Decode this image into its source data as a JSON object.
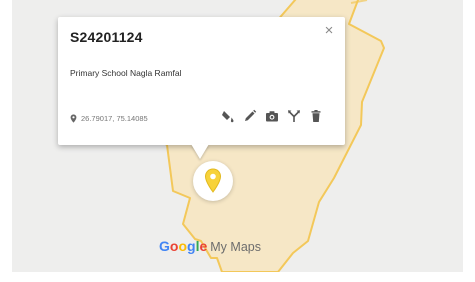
{
  "popup": {
    "title": "S24201124",
    "description": "Primary School Nagla Ramfal",
    "coordinates": "26.79017, 75.14085",
    "close_glyph": "×"
  },
  "toolbar": {
    "icons": [
      "style-icon",
      "edit-icon",
      "camera-icon",
      "directions-icon",
      "delete-icon"
    ]
  },
  "branding": {
    "logo_parts": [
      "G",
      "o",
      "o",
      "g",
      "l",
      "e"
    ],
    "product": "My Maps"
  },
  "colors": {
    "area_fill": "#F6E7C6",
    "area_stroke": "#F3C85A",
    "marker": "#F7D23A",
    "map_bg": "#EEEEED"
  }
}
